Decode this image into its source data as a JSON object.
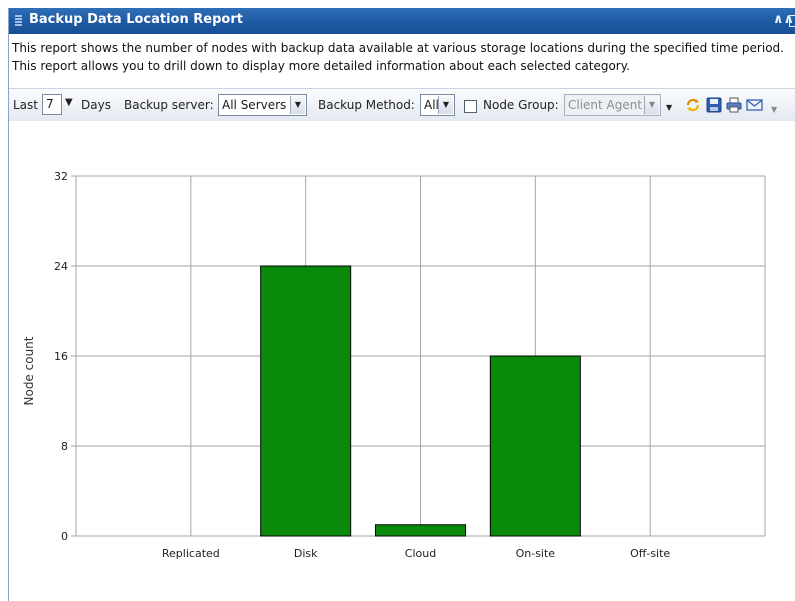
{
  "window": {
    "title": "Backup Data Location Report"
  },
  "description": "This report shows the number of nodes with backup data available at various storage locations during the specified time period. This report allows you to drill down to display more detailed information about each selected category.",
  "toolbar": {
    "last_label": "Last",
    "days_value": "7",
    "days_label": "Days",
    "backup_server_label": "Backup server:",
    "backup_server_value": "All Servers",
    "backup_method_label": "Backup Method:",
    "backup_method_value": "All",
    "node_group_checked": false,
    "node_group_label": "Node Group:",
    "node_group_value": "Client Agent"
  },
  "icons": [
    "down-arrow-icon",
    "chevron-down-icon",
    "refresh-icon",
    "save-icon",
    "print-icon",
    "email-icon"
  ],
  "colors": {
    "bar": "#0a8a0a",
    "title_bar": "#1e5aa4"
  },
  "chart_data": {
    "type": "bar",
    "categories": [
      "Replicated",
      "Disk",
      "Cloud",
      "On-site",
      "Off-site"
    ],
    "values": [
      0,
      24,
      1,
      16,
      0
    ],
    "ylabel": "Node count",
    "ylim": [
      0,
      32
    ],
    "yticks": [
      "0",
      "8",
      "16",
      "24",
      "32"
    ],
    "grid": true,
    "legend": "none"
  }
}
